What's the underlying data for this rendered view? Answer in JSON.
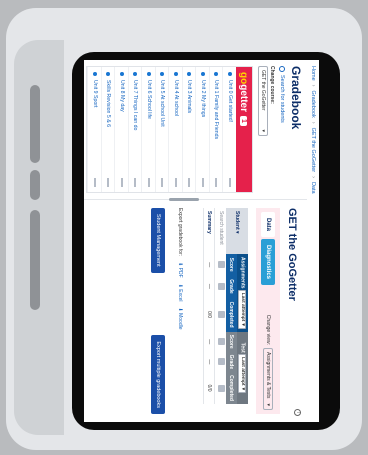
{
  "breadcrumb": {
    "items": [
      "Home",
      "Gradebook",
      "GET the GoGetter",
      "Data"
    ]
  },
  "left": {
    "title": "Gradebook",
    "search_placeholder": "Search for students",
    "change_course_label": "Change course:",
    "course_select_value": "GET the GoGetter",
    "brand_go": "go",
    "brand_getter": "getter",
    "brand_level": "1",
    "units": [
      "Unit 0 Get started!",
      "Unit 1 Family and Friends",
      "Unit 2 My things",
      "Unit 3 Animals",
      "Unit 4 At school",
      "Unit 5 At school Unit",
      "Unit 6 School life",
      "Unit 7 Things I can do",
      "Unit 8 My day",
      "Skills Revision 5 & 6",
      "Unit 9 Sport"
    ]
  },
  "right": {
    "title": "GET the GoGetter",
    "tabs": [
      "Data",
      "Diagnostics"
    ],
    "change_view_label": "Change view:",
    "change_view_value": "Assignments & Tests",
    "table": {
      "student_header": "Student",
      "assignments_header": "Assignments",
      "assignments_filter": "Last attempt",
      "test_header": "Test",
      "test_filter": "Last attempt",
      "sub_headers": [
        "Score",
        "Grade",
        "Completed",
        "Score",
        "Grade",
        "Completed"
      ],
      "rows": [
        {
          "student": "Search student",
          "cells": [
            "",
            "",
            "",
            "",
            "",
            ""
          ]
        },
        {
          "student": "Summary",
          "cells": [
            "—",
            "—",
            "0/0",
            "—",
            "—",
            "0/0"
          ]
        }
      ]
    },
    "export_label": "Export gradebook for:",
    "export_options": [
      "EXCEL",
      "PDF",
      "Excel",
      "Moodle"
    ],
    "buttons": {
      "student_management": "Student Management",
      "export_gradebook": "Export multiple gradebooks"
    }
  }
}
